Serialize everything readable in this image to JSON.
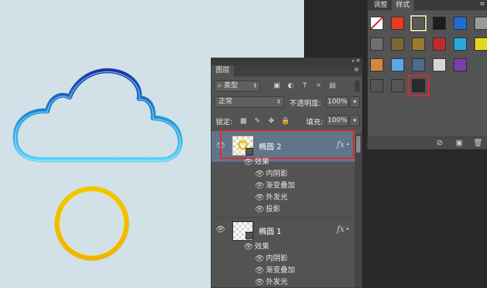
{
  "styles_panel": {
    "tabs": [
      "调整",
      "样式"
    ],
    "active_tab": "样式",
    "swatch_colors": [
      [
        "#ffffff",
        "#e83a1f",
        "#5a5a5a",
        "#1d1d1d",
        "#1f6ed4",
        "#9a9a9a"
      ],
      [
        "#6f6f6f",
        "#7b6636",
        "#9a7a2c",
        "#c22a2a",
        "#2aa8d9",
        "#e6d71c"
      ],
      [
        "#d5853d",
        "#5aa7e6",
        "#4c6c8c",
        "#d6d6d6",
        "#7a3fa8"
      ],
      [
        "#555555",
        "#555555",
        "#2a2a2a"
      ]
    ]
  },
  "layers_panel": {
    "title": "图层",
    "filter": {
      "label": "类型"
    },
    "blend_mode": "正常",
    "opacity_label": "不透明度:",
    "opacity_value": "100%",
    "lock_label": "锁定:",
    "fill_label": "填充:",
    "fill_value": "100%",
    "layers": [
      {
        "name": "椭圆 2",
        "fx": "fx",
        "effects_label": "效果",
        "effects": [
          "内阴影",
          "渐变叠加",
          "外发光",
          "投影"
        ]
      },
      {
        "name": "椭圆 1",
        "fx": "fx",
        "effects_label": "效果",
        "effects": [
          "内阴影",
          "渐变叠加",
          "外发光"
        ]
      }
    ]
  },
  "colors": {
    "cloud_outer": "#1a52b8",
    "cloud_inner": "#2fb6ea",
    "ring_outer": "#e8a800",
    "ring_inner": "#f8d830",
    "highlight": "#e0282b"
  }
}
